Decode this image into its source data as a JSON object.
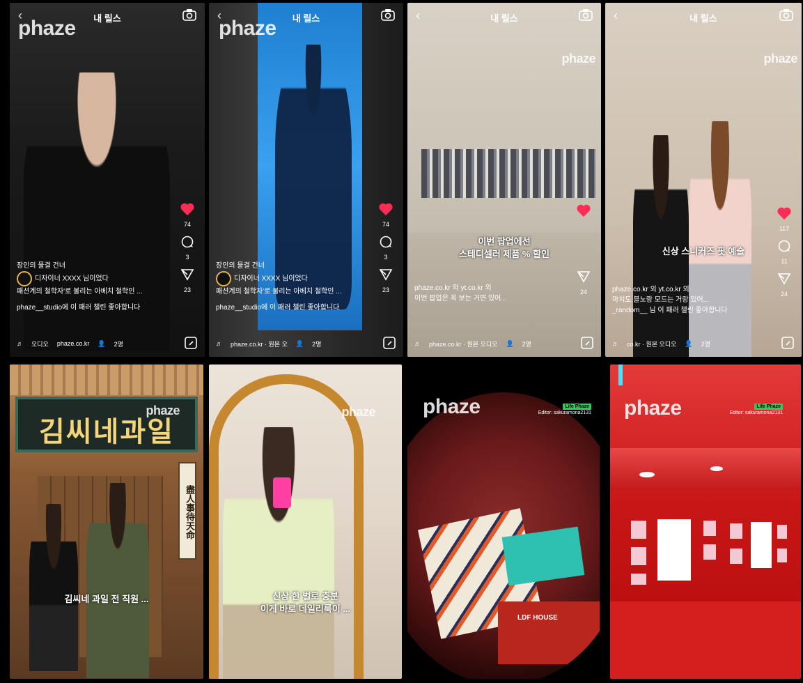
{
  "screen_title": "내 릴스",
  "brand": "phaze",
  "tiles": [
    {
      "likes": "74",
      "comments": "3",
      "shares": "23",
      "caption_tag": "장인의 물결 건너",
      "title_line": "디자이너 XXXX 님이었다",
      "desc_line": "패션계의 철학자'로 불리는 아베치 철학인 ...",
      "music_line": "phaze__studio에 이 패러 챌린 좋아합니다",
      "bottom_left": "오디오",
      "bottom_mid": "phaze.co.kr",
      "bottom_right": "2명"
    },
    {
      "likes": "74",
      "comments": "3",
      "shares": "23",
      "caption_tag": "장인의 물결 건너",
      "title_line": "디자이너 XXXX 님이었다",
      "desc_line": "패션계의 철학자'로 불리는 아베치 철학인 ...",
      "music_line": "phaze__studio에 이 패러 챌린 좋아합니다",
      "bottom_mid": "phaze.co.kr · 원본 오",
      "bottom_right": "2명"
    },
    {
      "caption_line1": "이번 팝업에선",
      "caption_line2": "스테디셀러 제품 % 할인",
      "shares": "24",
      "link_line": "phaze.co.kr 외 yt.co.kr 외",
      "desc_line": "이번 팝업은 꼭 보는 거면 있어...",
      "bottom_mid": "phaze.co.kr · 원본 오디오",
      "bottom_right": "2명"
    },
    {
      "caption_line": "신상 스니커즈 핏 예술",
      "likes": "117",
      "comments": "11",
      "shares": "24",
      "link_line": "phaze.co.kr 외 yt.co.kr 외",
      "desc_line": "마치도 블노랑 모드는 거랑 있어...",
      "music_line": "_random__ 님 이 패러 챌린 좋아합니다",
      "bottom_mid": "co.kr · 원본 오디오",
      "bottom_right": "2명"
    },
    {
      "sign_text": "김씨네과일",
      "side_sign": "盡人事待天命",
      "caption_line": "김씨네 과일 전 직원 ..."
    },
    {
      "caption_line1": "신상 한 벌로 충분",
      "caption_line2": "이게 바로 데일리룩이 ..."
    },
    {
      "tag_pill": "Life Phaze",
      "tag_sub": "Editor: sakuramona2131",
      "store_sign": "LDF HOUSE"
    },
    {
      "tag_pill": "Life Phaze",
      "tag_sub": "Editor: sakuramona2131"
    }
  ],
  "colors": {
    "like": "#ff2d55",
    "sign_text": "#f4d57a",
    "tag_pill": "#34c759",
    "red_room": "#c81616"
  },
  "icons": [
    "back-arrow-icon",
    "camera-icon",
    "heart-icon",
    "comment-icon",
    "share-icon",
    "edit-icon",
    "music-icon",
    "people-icon"
  ]
}
